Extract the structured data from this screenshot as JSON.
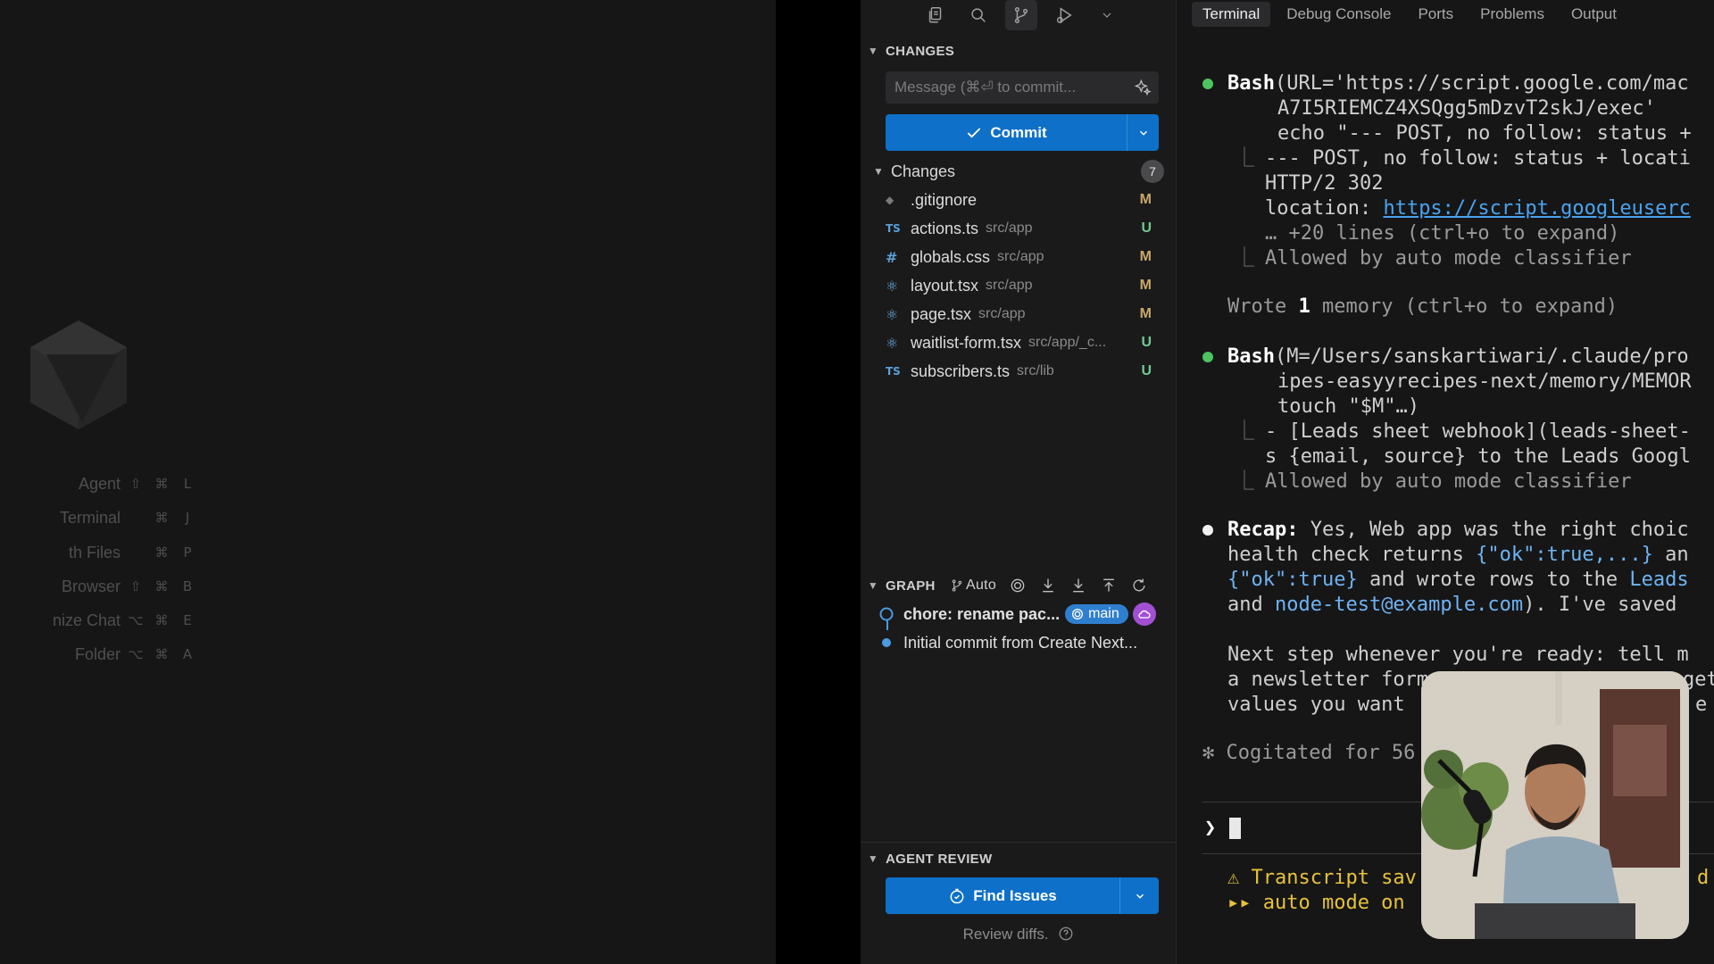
{
  "welcome": {
    "shortcuts": [
      {
        "label": "Agent",
        "keys": [
          "⇧",
          "⌘",
          "L"
        ]
      },
      {
        "label": "Terminal",
        "keys": [
          "⌘",
          "J"
        ]
      },
      {
        "label": "th Files",
        "keys": [
          "⌘",
          "P"
        ]
      },
      {
        "label": "Browser",
        "keys": [
          "⇧",
          "⌘",
          "B"
        ]
      },
      {
        "label": "nize Chat",
        "keys": [
          "⌥",
          "⌘",
          "E"
        ]
      },
      {
        "label": "Folder",
        "keys": [
          "⌥",
          "⌘",
          "A"
        ]
      }
    ]
  },
  "scm": {
    "section_title": "CHANGES",
    "commit_placeholder": "Message (⌘⏎ to commit...",
    "commit_label": "Commit",
    "changes_label": "Changes",
    "changes_count": "7",
    "files": [
      {
        "icon": "◆",
        "name": ".gitignore",
        "path": "",
        "status": "M"
      },
      {
        "icon": "TS",
        "name": "actions.ts",
        "path": "src/app",
        "status": "U"
      },
      {
        "icon": "#",
        "name": "globals.css",
        "path": "src/app",
        "status": "M"
      },
      {
        "icon": "⚛",
        "name": "layout.tsx",
        "path": "src/app",
        "status": "M"
      },
      {
        "icon": "⚛",
        "name": "page.tsx",
        "path": "src/app",
        "status": "M"
      },
      {
        "icon": "⚛",
        "name": "waitlist-form.tsx",
        "path": "src/app/_c...",
        "status": "U"
      },
      {
        "icon": "TS",
        "name": "subscribers.ts",
        "path": "src/lib",
        "status": "U"
      }
    ],
    "graph_title": "GRAPH",
    "graph_auto": "Auto",
    "commits": [
      {
        "message": "chore: rename pac...",
        "branch": "main"
      },
      {
        "message": "Initial commit from Create Next..."
      }
    ],
    "review_title": "AGENT REVIEW",
    "find_issues_label": "Find Issues",
    "review_diffs_label": "Review diffs."
  },
  "terminal": {
    "tabs": [
      "Terminal",
      "Debug Console",
      "Ports",
      "Problems",
      "Output"
    ],
    "active_tab": "Terminal",
    "lines": {
      "l1_tool": "Bash",
      "l1_rest": "(URL='https://script.google.com/mac",
      "l2": "A7I5RIEMCZ4XSQgg5mDzvT2skJ/exec'",
      "l3": "echo \"--- POST, no follow: status +",
      "l4": "--- POST, no follow: status + locati",
      "l5": "HTTP/2 302",
      "l6_key": "location: ",
      "l6_link": "https://script.googleuserc",
      "l7": "… +20 lines (ctrl+o to expand)",
      "l8": "Allowed by auto mode classifier",
      "l9_a": "Wrote ",
      "l9_b": "1",
      "l9_c": " memory (ctrl+o to expand)",
      "l10_tool": "Bash",
      "l10_rest": "(M=/Users/sanskartiwari/.claude/pro",
      "l11": "ipes-easyyrecipes-next/memory/MEMOR",
      "l12": "touch \"$M\"…)",
      "l13": "- [Leads sheet webhook](leads-sheet-",
      "l14": "s {email, source} to the Leads Googl",
      "l15": "Allowed by auto mode classifier",
      "l16_key": "Recap:",
      "l16_rest": " Yes, Web app was the right choic",
      "l17_a": "health check returns ",
      "l17_code": "{\"ok\":true,...}",
      "l17_b": " an",
      "l18_code": "{\"ok\":true}",
      "l18_b": " and wrote rows to the ",
      "l18_code2": "Leads",
      "l19_a": "and ",
      "l19_code": "node-test@example.com",
      "l19_b": "). I've saved",
      "l20": "Next step whenever you're ready: tell m",
      "l21": "a newsletter form",
      "l21_tail": "get",
      "l22": "values you want",
      "l22_tail": "e",
      "l23": "✻ Cogitated for 56",
      "prompt": "❯",
      "l24": "⚠ Transcript sav",
      "l24_tail": "d",
      "l25": "▸▸ auto mode on"
    }
  },
  "colors": {
    "accent_blue": "#0e70c8",
    "status_modified": "#c9a86a",
    "status_untracked": "#73c991",
    "success_bullet": "#4ec461",
    "warning": "#e6c23c",
    "branch_badge": "#2f7fd0",
    "cloud_badge": "#a24fd4"
  }
}
